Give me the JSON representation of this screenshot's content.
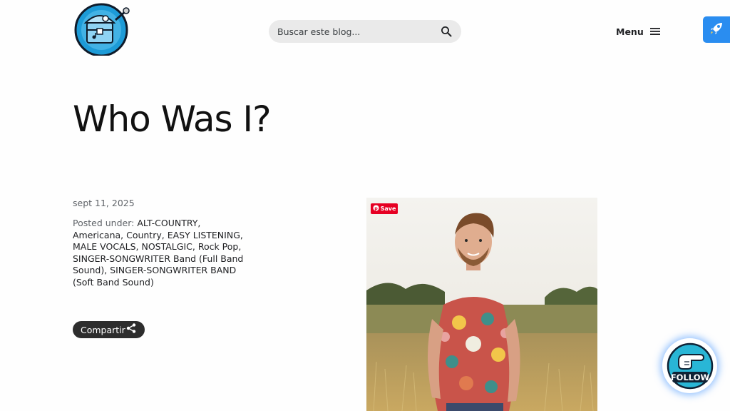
{
  "header": {
    "search": {
      "placeholder": "Buscar este blog..."
    },
    "menu_label": "Menu"
  },
  "post": {
    "title": "Who Was I?",
    "date": "sept 11, 2025",
    "posted_under_label": "Posted under:",
    "categories_text": "ALT-COUNTRY, Americana, Country, EASY LISTENING, MALE VOCALS, NOSTALGIC, Rock Pop, SINGER-SONGWRITER Band (Full Band Sound), SINGER-SONGWRITER BAND (Soft Band Sound)",
    "share_label": "Compartir"
  },
  "image": {
    "save_label": "Save"
  },
  "follow_badge": {
    "label": "FOLLOW"
  },
  "icons": {
    "search": "search-icon",
    "menu": "hamburger-icon",
    "share": "share-icon",
    "rocket": "rocket-icon",
    "pinterest": "pinterest-icon",
    "pointing_hand": "pointing-hand-icon"
  },
  "colors": {
    "logo_blue": "#1d9bd7",
    "share_bg": "#2d2d2d",
    "rocket_bg": "#2a8df0",
    "save_red": "#e60023",
    "follow_teal": "#29b6d6"
  }
}
